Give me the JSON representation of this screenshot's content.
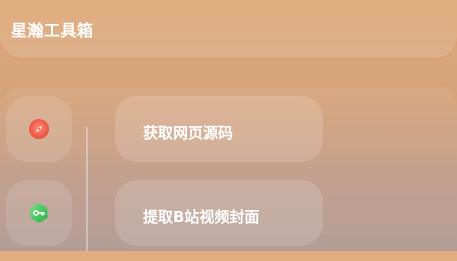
{
  "app": {
    "title": "星瀚工具箱"
  },
  "tools": [
    {
      "label": "获取网页源码",
      "icon": "compass-icon",
      "icon_color": "#f15a4a"
    },
    {
      "label": "提取B站视频封面",
      "icon": "key-icon",
      "icon_color": "#3cc15c"
    }
  ],
  "colors": {
    "background_top": "#e2ab7c",
    "background_bottom": "#b29a90",
    "text": "#ffffff"
  }
}
